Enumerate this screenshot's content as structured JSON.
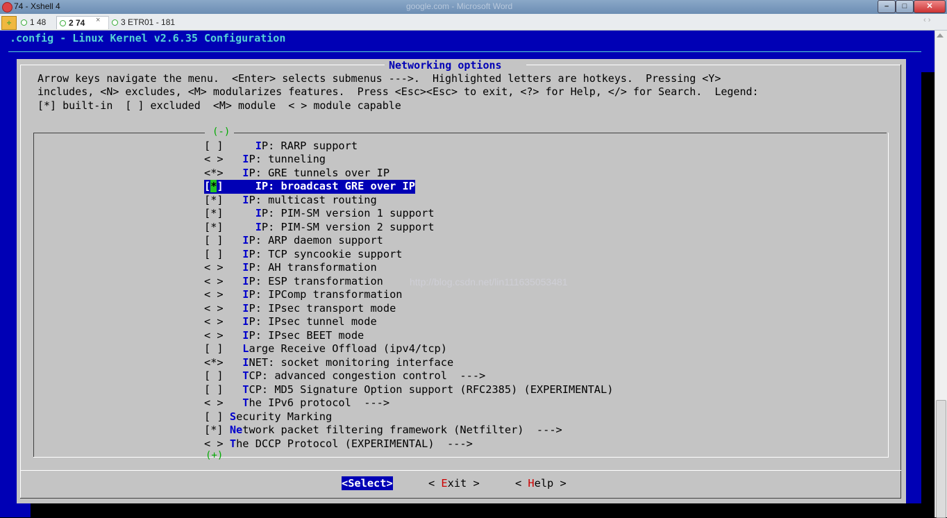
{
  "window": {
    "title": "74 - Xshell 4",
    "ghost_title": "google.com - Microsoft Word",
    "buttons": {
      "min": "–",
      "max": "□",
      "close": "✕"
    }
  },
  "tabs": [
    {
      "label": "1 48"
    },
    {
      "label": "2 74",
      "active": true,
      "close": "×"
    },
    {
      "label": "3 ETR01 - 181"
    }
  ],
  "tab_add": "+",
  "tab_nav": "‹ ›",
  "terminal": {
    "header": ".config - Linux Kernel v2.6.35 Configuration",
    "dialog_title": "Networking options",
    "help_lines": [
      "Arrow keys navigate the menu.  <Enter> selects submenus --->.  Highlighted letters are hotkeys.  Pressing <Y>",
      "includes, <N> excludes, <M> modularizes features.  Press <Esc><Esc> to exit, <?> for Help, </> for Search.  Legend:",
      "[*] built-in  [ ] excluded  <M> module  < > module capable"
    ],
    "scroll_up": "(-)",
    "scroll_down": "(+)",
    "watermark": "http://blog.csdn.net/lin111635053481",
    "items": [
      {
        "pre": "[ ]     ",
        "hk": "I",
        "rest": "P: RARP support"
      },
      {
        "pre": "< >   ",
        "hk": "I",
        "rest": "P: tunneling"
      },
      {
        "pre": "<*>   ",
        "hk": "I",
        "rest": "P: GRE tunnels over IP"
      },
      {
        "pre": "[*]     ",
        "hk": "I",
        "rest": "P: broadcast GRE over IP",
        "selected": true
      },
      {
        "pre": "[*]   ",
        "hk": "I",
        "rest": "P: multicast routing"
      },
      {
        "pre": "[*]     ",
        "hk": "I",
        "rest": "P: PIM-SM version 1 support"
      },
      {
        "pre": "[*]     ",
        "hk": "I",
        "rest": "P: PIM-SM version 2 support"
      },
      {
        "pre": "[ ]   ",
        "hk": "I",
        "rest": "P: ARP daemon support"
      },
      {
        "pre": "[ ]   ",
        "hk": "I",
        "rest": "P: TCP syncookie support"
      },
      {
        "pre": "< >   ",
        "hk": "I",
        "rest": "P: AH transformation"
      },
      {
        "pre": "< >   ",
        "hk": "I",
        "rest": "P: ESP transformation"
      },
      {
        "pre": "< >   ",
        "hk": "I",
        "rest": "P: IPComp transformation"
      },
      {
        "pre": "< >   ",
        "hk": "I",
        "rest": "P: IPsec transport mode"
      },
      {
        "pre": "< >   ",
        "hk": "I",
        "rest": "P: IPsec tunnel mode"
      },
      {
        "pre": "< >   ",
        "hk": "I",
        "rest": "P: IPsec BEET mode"
      },
      {
        "pre": "[ ]   ",
        "hk": "L",
        "rest": "arge Receive Offload (ipv4/tcp)"
      },
      {
        "pre": "<*>   ",
        "hk": "I",
        "rest": "NET: socket monitoring interface"
      },
      {
        "pre": "[ ]   ",
        "hk": "T",
        "rest": "CP: advanced congestion control  --->"
      },
      {
        "pre": "[ ]   ",
        "hk": "T",
        "rest": "CP: MD5 Signature Option support (RFC2385) (EXPERIMENTAL)"
      },
      {
        "pre": "< >   ",
        "hk": "T",
        "rest": "he IPv6 protocol  --->"
      },
      {
        "pre": "[ ] ",
        "hk": "S",
        "rest": "ecurity Marking"
      },
      {
        "pre": "[*] ",
        "hk": "Ne",
        "rest": "twork packet filtering framework (Netfilter)  --->"
      },
      {
        "pre": "< > ",
        "hk": "T",
        "rest": "he DCCP Protocol (EXPERIMENTAL)  --->"
      }
    ],
    "buttons": {
      "select": "<Select>",
      "exit_pre": "< ",
      "exit_hk": "E",
      "exit_rest": "xit >",
      "help_pre": "< ",
      "help_hk": "H",
      "help_rest": "elp >"
    }
  }
}
